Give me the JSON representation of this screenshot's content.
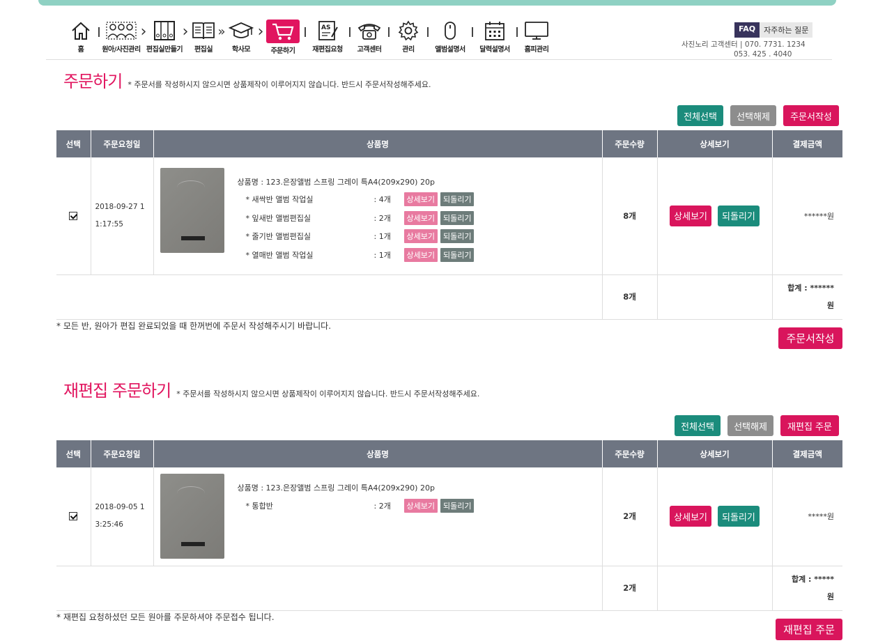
{
  "nav": {
    "items": [
      {
        "label": "홈",
        "icon": "home-icon"
      },
      {
        "label": "원아/사진관리",
        "icon": "children-icon"
      },
      {
        "label": "편집실만들기",
        "icon": "binder-icon"
      },
      {
        "label": "편집실",
        "icon": "book-icon"
      },
      {
        "label": "학사모",
        "icon": "graduation-cap-icon"
      },
      {
        "label": "주문하기",
        "icon": "cart-icon"
      },
      {
        "label": "재편집요청",
        "icon": "as-document-icon"
      },
      {
        "label": "고객센터",
        "icon": "phone-icon"
      },
      {
        "label": "관리",
        "icon": "gear-icon"
      },
      {
        "label": "앨범설명서",
        "icon": "mouse-icon"
      },
      {
        "label": "달력설명서",
        "icon": "calendar-icon"
      },
      {
        "label": "홈피관리",
        "icon": "monitor-icon"
      }
    ]
  },
  "faq": {
    "tag": "FAQ",
    "text": "자주하는 질문"
  },
  "customer_center": {
    "line1": "사진노리 고객센터 |  070. 7731. 1234",
    "line2": "053. 425 . 4040"
  },
  "order": {
    "title": "주문하기",
    "note": "* 주문서를 작성하시지 않으시면 상품제작이 이루어지지 않습니다. 반드시 주문서작성해주세요.",
    "btn_select_all": "전체선택",
    "btn_deselect": "선택해제",
    "btn_write": "주문서작성",
    "headers": [
      "선택",
      "주문요청일",
      "상품명",
      "주문수량",
      "상세보기",
      "결제금액"
    ],
    "row": {
      "checked": true,
      "date_line1": "2018-09-27 1",
      "date_line2": "1:17:55",
      "product_name": "상품명 : 123.은장앨범 스프링 그레이 특A4(209x290) 20p",
      "subs": [
        {
          "name": "* 새싹반 앨범 작업실",
          "qty": ": 4개"
        },
        {
          "name": "* 잎새반 앨범편집실",
          "qty": ": 2개"
        },
        {
          "name": "* 줄기반 앨범편집실",
          "qty": ": 1개"
        },
        {
          "name": "* 열매반 앨범 작업실",
          "qty": ": 1개"
        }
      ],
      "mini_detail": "상세보기",
      "mini_revert": "되돌리기",
      "qty": "8개",
      "detail": "상세보기",
      "revert": "되돌리기",
      "price": "******원"
    },
    "sum_qty": "8개",
    "sum_line1": "합계 : ******",
    "sum_line2": "원",
    "footer_note": "* 모든 반, 원아가 편집 완료되었을 때 한꺼번에 주문서 작성해주시기 바랍니다.",
    "bottom_btn": "주문서작성"
  },
  "reedit": {
    "title": "재편집 주문하기",
    "note": "* 주문서를 작성하시지 않으시면 상품제작이 이루어지지 않습니다. 반드시 주문서작성해주세요.",
    "btn_select_all": "전체선택",
    "btn_deselect": "선택해제",
    "btn_order": "재편집 주문",
    "headers": [
      "선택",
      "주문요청일",
      "상품명",
      "주문수량",
      "상세보기",
      "결제금액"
    ],
    "row": {
      "checked": true,
      "date_line1": "2018-09-05 1",
      "date_line2": "3:25:46",
      "product_name": "상품명 : 123.은장앨범 스프링 그레이 특A4(209x290) 20p",
      "subs": [
        {
          "name": "* 통합반",
          "qty": ": 2개"
        }
      ],
      "mini_detail": "상세보기",
      "mini_revert": "되돌리기",
      "qty": "2개",
      "detail": "상세보기",
      "revert": "되돌리기",
      "price": "*****원"
    },
    "sum_qty": "2개",
    "sum_line1": "합계 : *****",
    "sum_line2": "원",
    "footer_note": "* 재편집 요청하셨던 모든 원아를 주문하셔야 주문접수 됩니다.",
    "bottom_btn": "재편집 주문"
  },
  "colors": {
    "accent": "#e1155f",
    "teal": "#1b8c7c",
    "gray": "#8d8d8d",
    "header": "#6e7582"
  }
}
